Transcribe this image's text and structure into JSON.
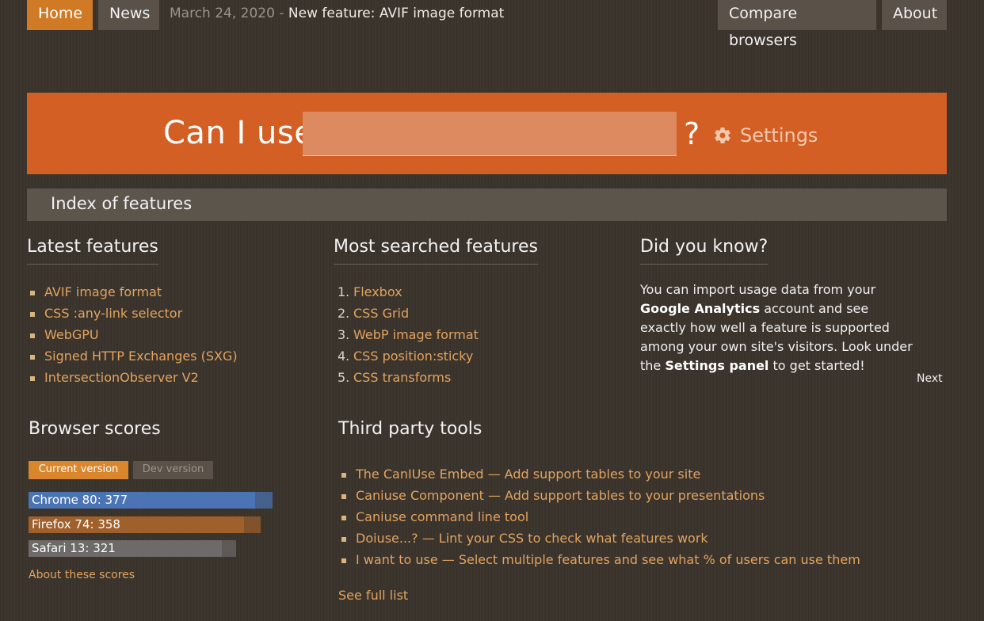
{
  "nav": {
    "home": "Home",
    "news": "News",
    "news_date": "March 24, 2020",
    "news_separator": "-",
    "news_title": "New feature: AVIF image format",
    "compare": "Compare browsers",
    "about": "About"
  },
  "search": {
    "label": "Can I use",
    "value": "",
    "question": "?",
    "settings_label": "Settings",
    "settings_icon": "gear-icon"
  },
  "index_title": "Index of features",
  "latest": {
    "title": "Latest features",
    "items": [
      "AVIF image format",
      "CSS :any-link selector",
      "WebGPU",
      "Signed HTTP Exchanges (SXG)",
      "IntersectionObserver V2"
    ]
  },
  "most_searched": {
    "title": "Most searched features",
    "items": [
      {
        "num": "1.",
        "label": "Flexbox"
      },
      {
        "num": "2.",
        "label": "CSS Grid"
      },
      {
        "num": "3.",
        "label": "WebP image format"
      },
      {
        "num": "4.",
        "label": "CSS position:sticky"
      },
      {
        "num": "5.",
        "label": "CSS transforms"
      }
    ]
  },
  "did_you_know": {
    "title": "Did you know?",
    "text1": "You can import usage data from your ",
    "bold1": "Google Analytics",
    "text2": " account and see exactly how well a feature is supported among your own site's visitors. Look under the ",
    "bold2": "Settings panel",
    "text3": " to get started!",
    "next": "Next"
  },
  "browser_scores": {
    "title": "Browser scores",
    "current_label": "Current version",
    "dev_label": "Dev version",
    "max_score": 400,
    "scores": [
      {
        "label": "Chrome 80: 377",
        "score": 377,
        "color": "#4a74b5"
      },
      {
        "label": "Firefox 74: 358",
        "score": 358,
        "color": "#a0602b"
      },
      {
        "label": "Safari 13: 321",
        "score": 321,
        "color": "#6d6a69"
      }
    ],
    "about_link": "About these scores"
  },
  "third_party": {
    "title": "Third party tools",
    "items": [
      "The CanIUse Embed — Add support tables to your site",
      "Caniuse Component — Add support tables to your presentations",
      "Caniuse command line tool",
      "Doiuse...? — Lint your CSS to check what features work",
      "I want to use — Select multiple features and see what % of users can use them"
    ],
    "see_full": "See full list"
  }
}
